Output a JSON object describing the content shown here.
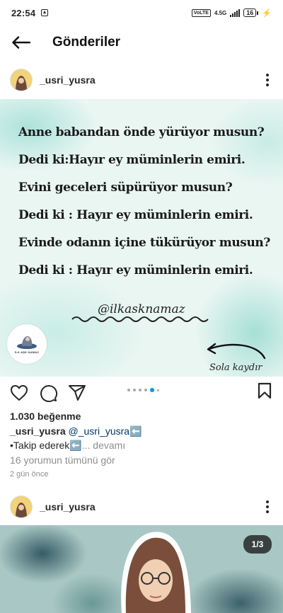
{
  "status_bar": {
    "time": "22:54",
    "volte_label": "VoLTE",
    "network_label": "4.5G",
    "battery": "16"
  },
  "header": {
    "title": "Gönderiler"
  },
  "post1": {
    "username": "_usri_yusra",
    "image": {
      "lines": [
        "Anne babandan önde yürüyor musun?",
        "Dedi ki:Hayır ey müminlerin emiri.",
        "Evini geceleri süpürüyor musun?",
        "Dedi ki : Hayır ey müminlerin emiri.",
        "Evinde odanın içine tükürüyor musun?",
        "Dedi ki : Hayır ey müminlerin emiri."
      ],
      "handle": "@ilkasknamaz",
      "logo_text": "İLK AŞK NAMAZ",
      "swipe_text": "Sola kaydır"
    },
    "carousel": {
      "count": 6,
      "active_index": 4
    },
    "likes": "1.030 beğenme",
    "caption_username": "_usri_yusra",
    "caption_mention": "@_usri_yusra",
    "caption_emoji": "⬅️",
    "caption_line2": "•Takip ederek",
    "caption_more": "... devamı",
    "comments_link": "16 yorumun tümünü gör",
    "time_ago": "2 gün önce"
  },
  "post2": {
    "username": "_usri_yusra",
    "counter": "1/3"
  },
  "colors": {
    "accent": "#0095f6",
    "mention": "#00376b",
    "muted": "#8e8e8e"
  }
}
